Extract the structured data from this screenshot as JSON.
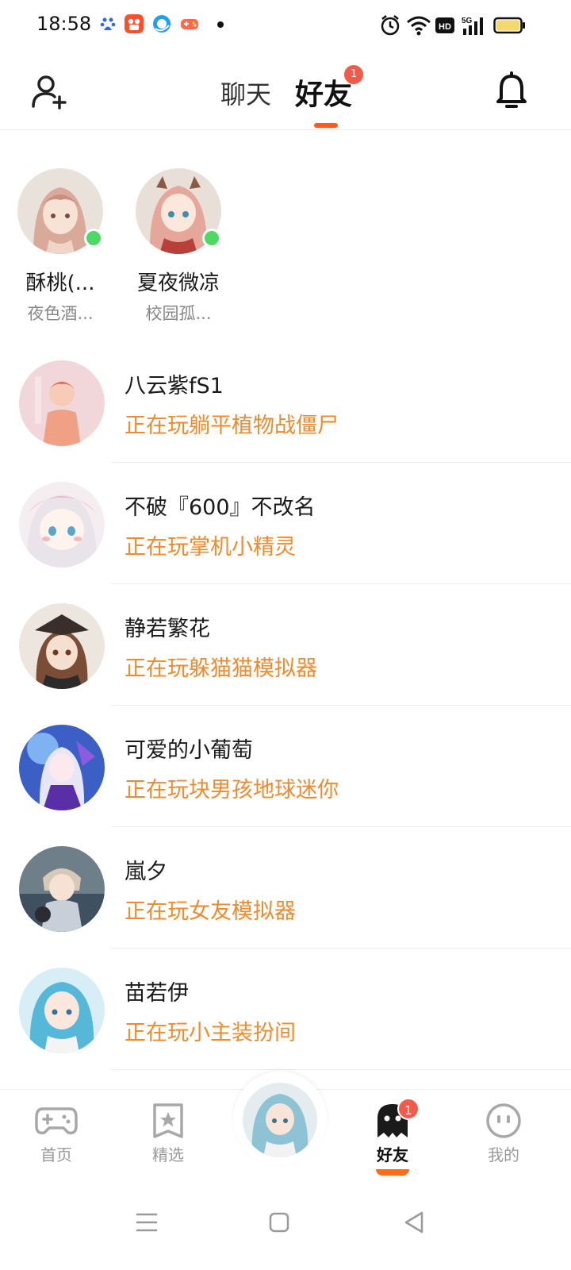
{
  "status_bar": {
    "time": "18:58",
    "app_icons": [
      "baidu-icon",
      "kuaishou-icon",
      "browser-icon",
      "game-icon"
    ],
    "indicators": [
      "alarm-icon",
      "wifi-icon",
      "hd-icon",
      "5g-signal-icon",
      "battery-icon"
    ]
  },
  "header": {
    "tabs": [
      {
        "label": "聊天",
        "active": false
      },
      {
        "label": "好友",
        "active": true,
        "badge": "1"
      }
    ],
    "accent_color": "#ff5a1f"
  },
  "online_friends": [
    {
      "name": "酥桃(...",
      "subtitle": "夜色酒...",
      "online": true
    },
    {
      "name": "夏夜微凉",
      "subtitle": "校园孤...",
      "online": true
    }
  ],
  "friends": [
    {
      "name": "八云紫fS1",
      "status": "正在玩躺平植物战僵尸"
    },
    {
      "name": "不破『600』不改名",
      "status": "正在玩掌机小精灵"
    },
    {
      "name": "静若繁花",
      "status": "正在玩躲猫猫模拟器"
    },
    {
      "name": "可爱的小葡萄",
      "status": "正在玩块男孩地球迷你"
    },
    {
      "name": "嵐夕",
      "status": "正在玩女友模拟器"
    },
    {
      "name": "苗若伊",
      "status": "正在玩小主装扮间"
    }
  ],
  "bottom_nav": {
    "items": [
      {
        "label": "首页",
        "icon": "gamepad-icon",
        "active": false
      },
      {
        "label": "精选",
        "icon": "star-bookmark-icon",
        "active": false
      },
      {
        "label": "好友",
        "icon": "ghost-icon",
        "active": true,
        "badge": "1"
      },
      {
        "label": "我的",
        "icon": "face-icon",
        "active": false
      }
    ]
  },
  "colors": {
    "status_text": "#f08a2c",
    "online_dot": "#4cd964",
    "badge": "#f25a4a"
  }
}
